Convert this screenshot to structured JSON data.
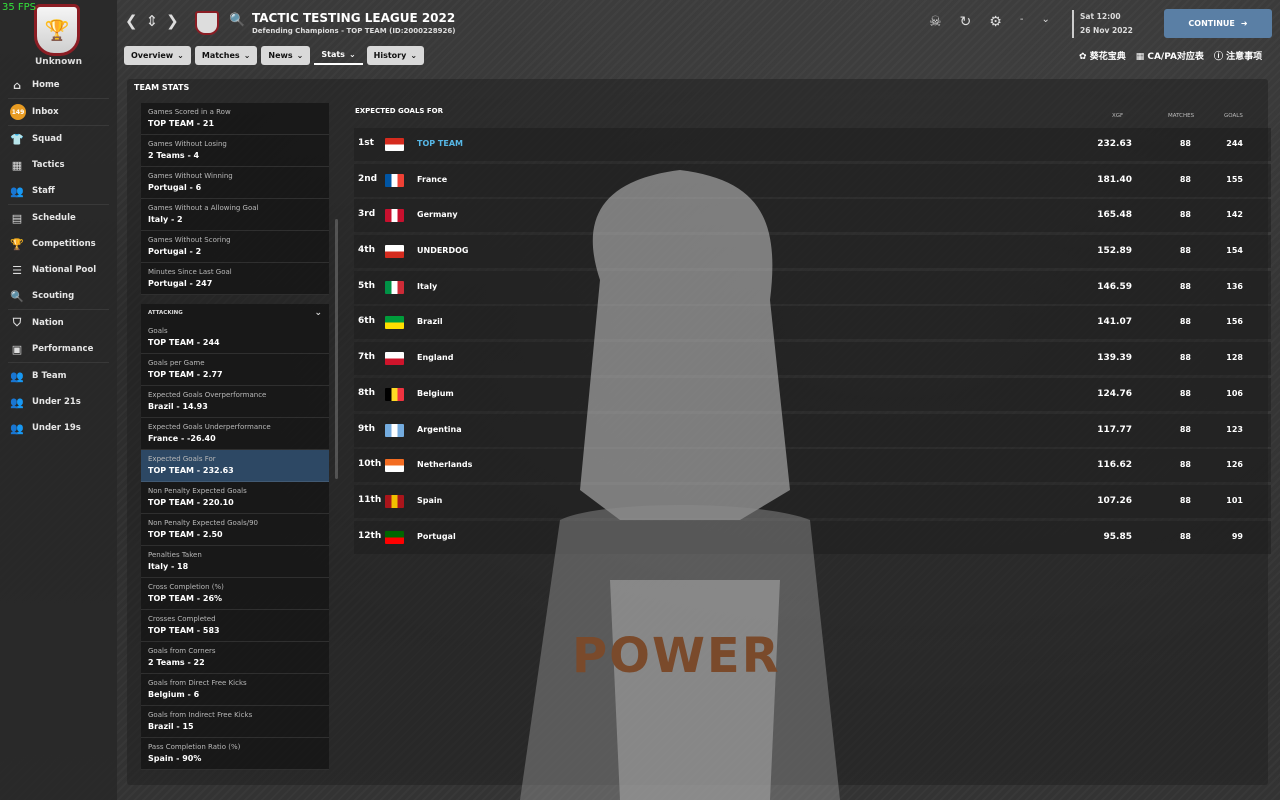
{
  "fps": "35 FPS",
  "club": {
    "name": "Unknown"
  },
  "sidebar": {
    "inbox_count": "149",
    "items": [
      {
        "label": "Home",
        "icon": "home-icon"
      },
      {
        "label": "Inbox",
        "icon": "inbox-icon"
      },
      {
        "label": "Squad",
        "icon": "shirt-icon"
      },
      {
        "label": "Tactics",
        "icon": "tactics-icon"
      },
      {
        "label": "Staff",
        "icon": "staff-icon"
      },
      {
        "label": "Schedule",
        "icon": "calendar-icon"
      },
      {
        "label": "Competitions",
        "icon": "trophy-icon"
      },
      {
        "label": "National Pool",
        "icon": "list-icon"
      },
      {
        "label": "Scouting",
        "icon": "search-icon"
      },
      {
        "label": "Nation",
        "icon": "shield-icon"
      },
      {
        "label": "Performance",
        "icon": "performance-icon"
      },
      {
        "label": "B Team",
        "icon": "b-team-icon"
      },
      {
        "label": "Under 21s",
        "icon": "u21-icon"
      },
      {
        "label": "Under 19s",
        "icon": "u19-icon"
      }
    ]
  },
  "header": {
    "title": "TACTIC TESTING LEAGUE 2022",
    "subtitle": "Defending Champions - TOP TEAM (ID:2000228926)",
    "tabs": [
      "Overview",
      "Matches",
      "News",
      "Stats",
      "History"
    ],
    "active_tab": "Stats",
    "date_line1": "Sat 12:00",
    "date_line2": "26 Nov 2022",
    "dash": "-",
    "continue_label": "CONTINUE",
    "links": [
      "葵花宝典",
      "CA/PA对应表",
      "注意事项"
    ]
  },
  "main": {
    "section_title": "TEAM STATS",
    "stats_top": [
      {
        "label": "Games Scored in a Row",
        "value": "TOP TEAM - 21"
      },
      {
        "label": "Games Without Losing",
        "value": "2 Teams - 4"
      },
      {
        "label": "Games Without Winning",
        "value": "Portugal - 6"
      },
      {
        "label": "Games Without a Allowing Goal",
        "value": "Italy - 2"
      },
      {
        "label": "Games Without Scoring",
        "value": "Portugal - 2"
      },
      {
        "label": "Minutes Since Last Goal",
        "value": "Portugal - 247"
      }
    ],
    "attacking_header": "ATTACKING",
    "stats_attacking": [
      {
        "label": "Goals",
        "value": "TOP TEAM - 244"
      },
      {
        "label": "Goals per Game",
        "value": "TOP TEAM - 2.77"
      },
      {
        "label": "Expected Goals Overperformance",
        "value": "Brazil - 14.93"
      },
      {
        "label": "Expected Goals Underperformance",
        "value": "France - -26.40"
      },
      {
        "label": "Expected Goals For",
        "value": "TOP TEAM - 232.63"
      },
      {
        "label": "Non Penalty Expected Goals",
        "value": "TOP TEAM - 220.10"
      },
      {
        "label": "Non Penalty Expected Goals/90",
        "value": "TOP TEAM - 2.50"
      },
      {
        "label": "Penalties Taken",
        "value": "Italy - 18"
      },
      {
        "label": "Cross Completion (%)",
        "value": "TOP TEAM - 26%"
      },
      {
        "label": "Crosses Completed",
        "value": "TOP TEAM - 583"
      },
      {
        "label": "Goals from Corners",
        "value": "2 Teams - 22"
      },
      {
        "label": "Goals from Direct Free Kicks",
        "value": "Belgium - 6"
      },
      {
        "label": "Goals from Indirect Free Kicks",
        "value": "Brazil - 15"
      },
      {
        "label": "Pass Completion Ratio (%)",
        "value": "Spain - 90%"
      }
    ],
    "selected_stat": "Expected Goals For",
    "table": {
      "title": "EXPECTED GOALS FOR",
      "columns": [
        "XGF",
        "MATCHES",
        "GOALS"
      ],
      "rows": [
        {
          "pos": "1st",
          "team": "TOP TEAM",
          "xgf": "232.63",
          "matches": "88",
          "goals": "244",
          "flag": [
            "#d52b1e",
            "#ffffff"
          ]
        },
        {
          "pos": "2nd",
          "team": "France",
          "xgf": "181.40",
          "matches": "88",
          "goals": "155",
          "flag": [
            "#0055a4",
            "#ffffff",
            "#ef4135"
          ]
        },
        {
          "pos": "3rd",
          "team": "Germany",
          "xgf": "165.48",
          "matches": "88",
          "goals": "142",
          "flag": [
            "#c8102e",
            "#ffffff",
            "#c8102e"
          ]
        },
        {
          "pos": "4th",
          "team": "UNDERDOG",
          "xgf": "152.89",
          "matches": "88",
          "goals": "154",
          "flag": [
            "#ffffff",
            "#d52b1e"
          ]
        },
        {
          "pos": "5th",
          "team": "Italy",
          "xgf": "146.59",
          "matches": "88",
          "goals": "136",
          "flag": [
            "#009246",
            "#ffffff",
            "#ce2b37"
          ]
        },
        {
          "pos": "6th",
          "team": "Brazil",
          "xgf": "141.07",
          "matches": "88",
          "goals": "156",
          "flag": [
            "#009c3b",
            "#ffdf00"
          ]
        },
        {
          "pos": "7th",
          "team": "England",
          "xgf": "139.39",
          "matches": "88",
          "goals": "128",
          "flag": [
            "#ffffff",
            "#cf142b"
          ]
        },
        {
          "pos": "8th",
          "team": "Belgium",
          "xgf": "124.76",
          "matches": "88",
          "goals": "106",
          "flag": [
            "#000000",
            "#fdda24",
            "#ef3340"
          ]
        },
        {
          "pos": "9th",
          "team": "Argentina",
          "xgf": "117.77",
          "matches": "88",
          "goals": "123",
          "flag": [
            "#74acdf",
            "#ffffff",
            "#74acdf"
          ]
        },
        {
          "pos": "10th",
          "team": "Netherlands",
          "xgf": "116.62",
          "matches": "88",
          "goals": "126",
          "flag": [
            "#f36c21",
            "#ffffff"
          ]
        },
        {
          "pos": "11th",
          "team": "Spain",
          "xgf": "107.26",
          "matches": "88",
          "goals": "101",
          "flag": [
            "#aa151b",
            "#f1bf00",
            "#aa151b"
          ]
        },
        {
          "pos": "12th",
          "team": "Portugal",
          "xgf": "95.85",
          "matches": "88",
          "goals": "99",
          "flag": [
            "#006600",
            "#ff0000"
          ]
        }
      ]
    }
  },
  "overlay_text": "POWER"
}
